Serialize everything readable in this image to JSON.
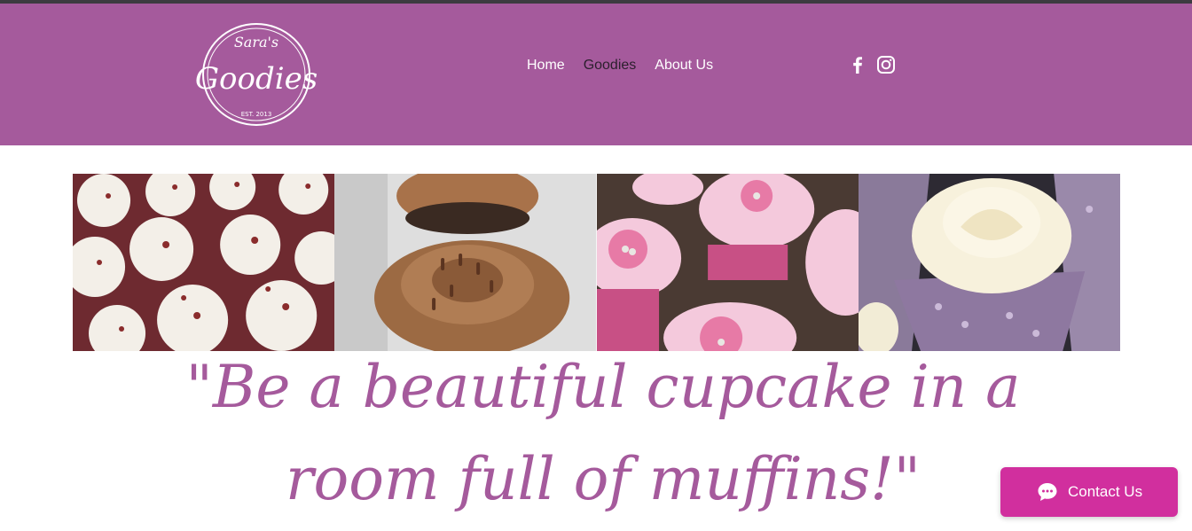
{
  "brand": {
    "logo_top": "Sara's",
    "logo_main": "Goodies",
    "logo_bottom": "EST. 2013"
  },
  "nav": {
    "items": [
      {
        "label": "Home"
      },
      {
        "label": "Goodies",
        "active": true
      },
      {
        "label": "About Us"
      }
    ]
  },
  "social": {
    "icons": [
      "facebook-icon",
      "instagram-icon"
    ]
  },
  "gallery": {
    "images": [
      "red-velvet-cupcakes",
      "chocolate-cupcake",
      "pink-flower-cupcakes",
      "vanilla-cupcake-purple-wrapper"
    ]
  },
  "quote": {
    "text": "\"Be a beautiful cupcake in a room full of muffins!\""
  },
  "contact": {
    "label": "Contact Us",
    "icon": "chat-icon"
  },
  "colors": {
    "header_bg": "#a55a9c",
    "quote_text": "#a55a9c",
    "contact_bg": "#d12f9e",
    "active_nav": "#2b1f2d"
  }
}
